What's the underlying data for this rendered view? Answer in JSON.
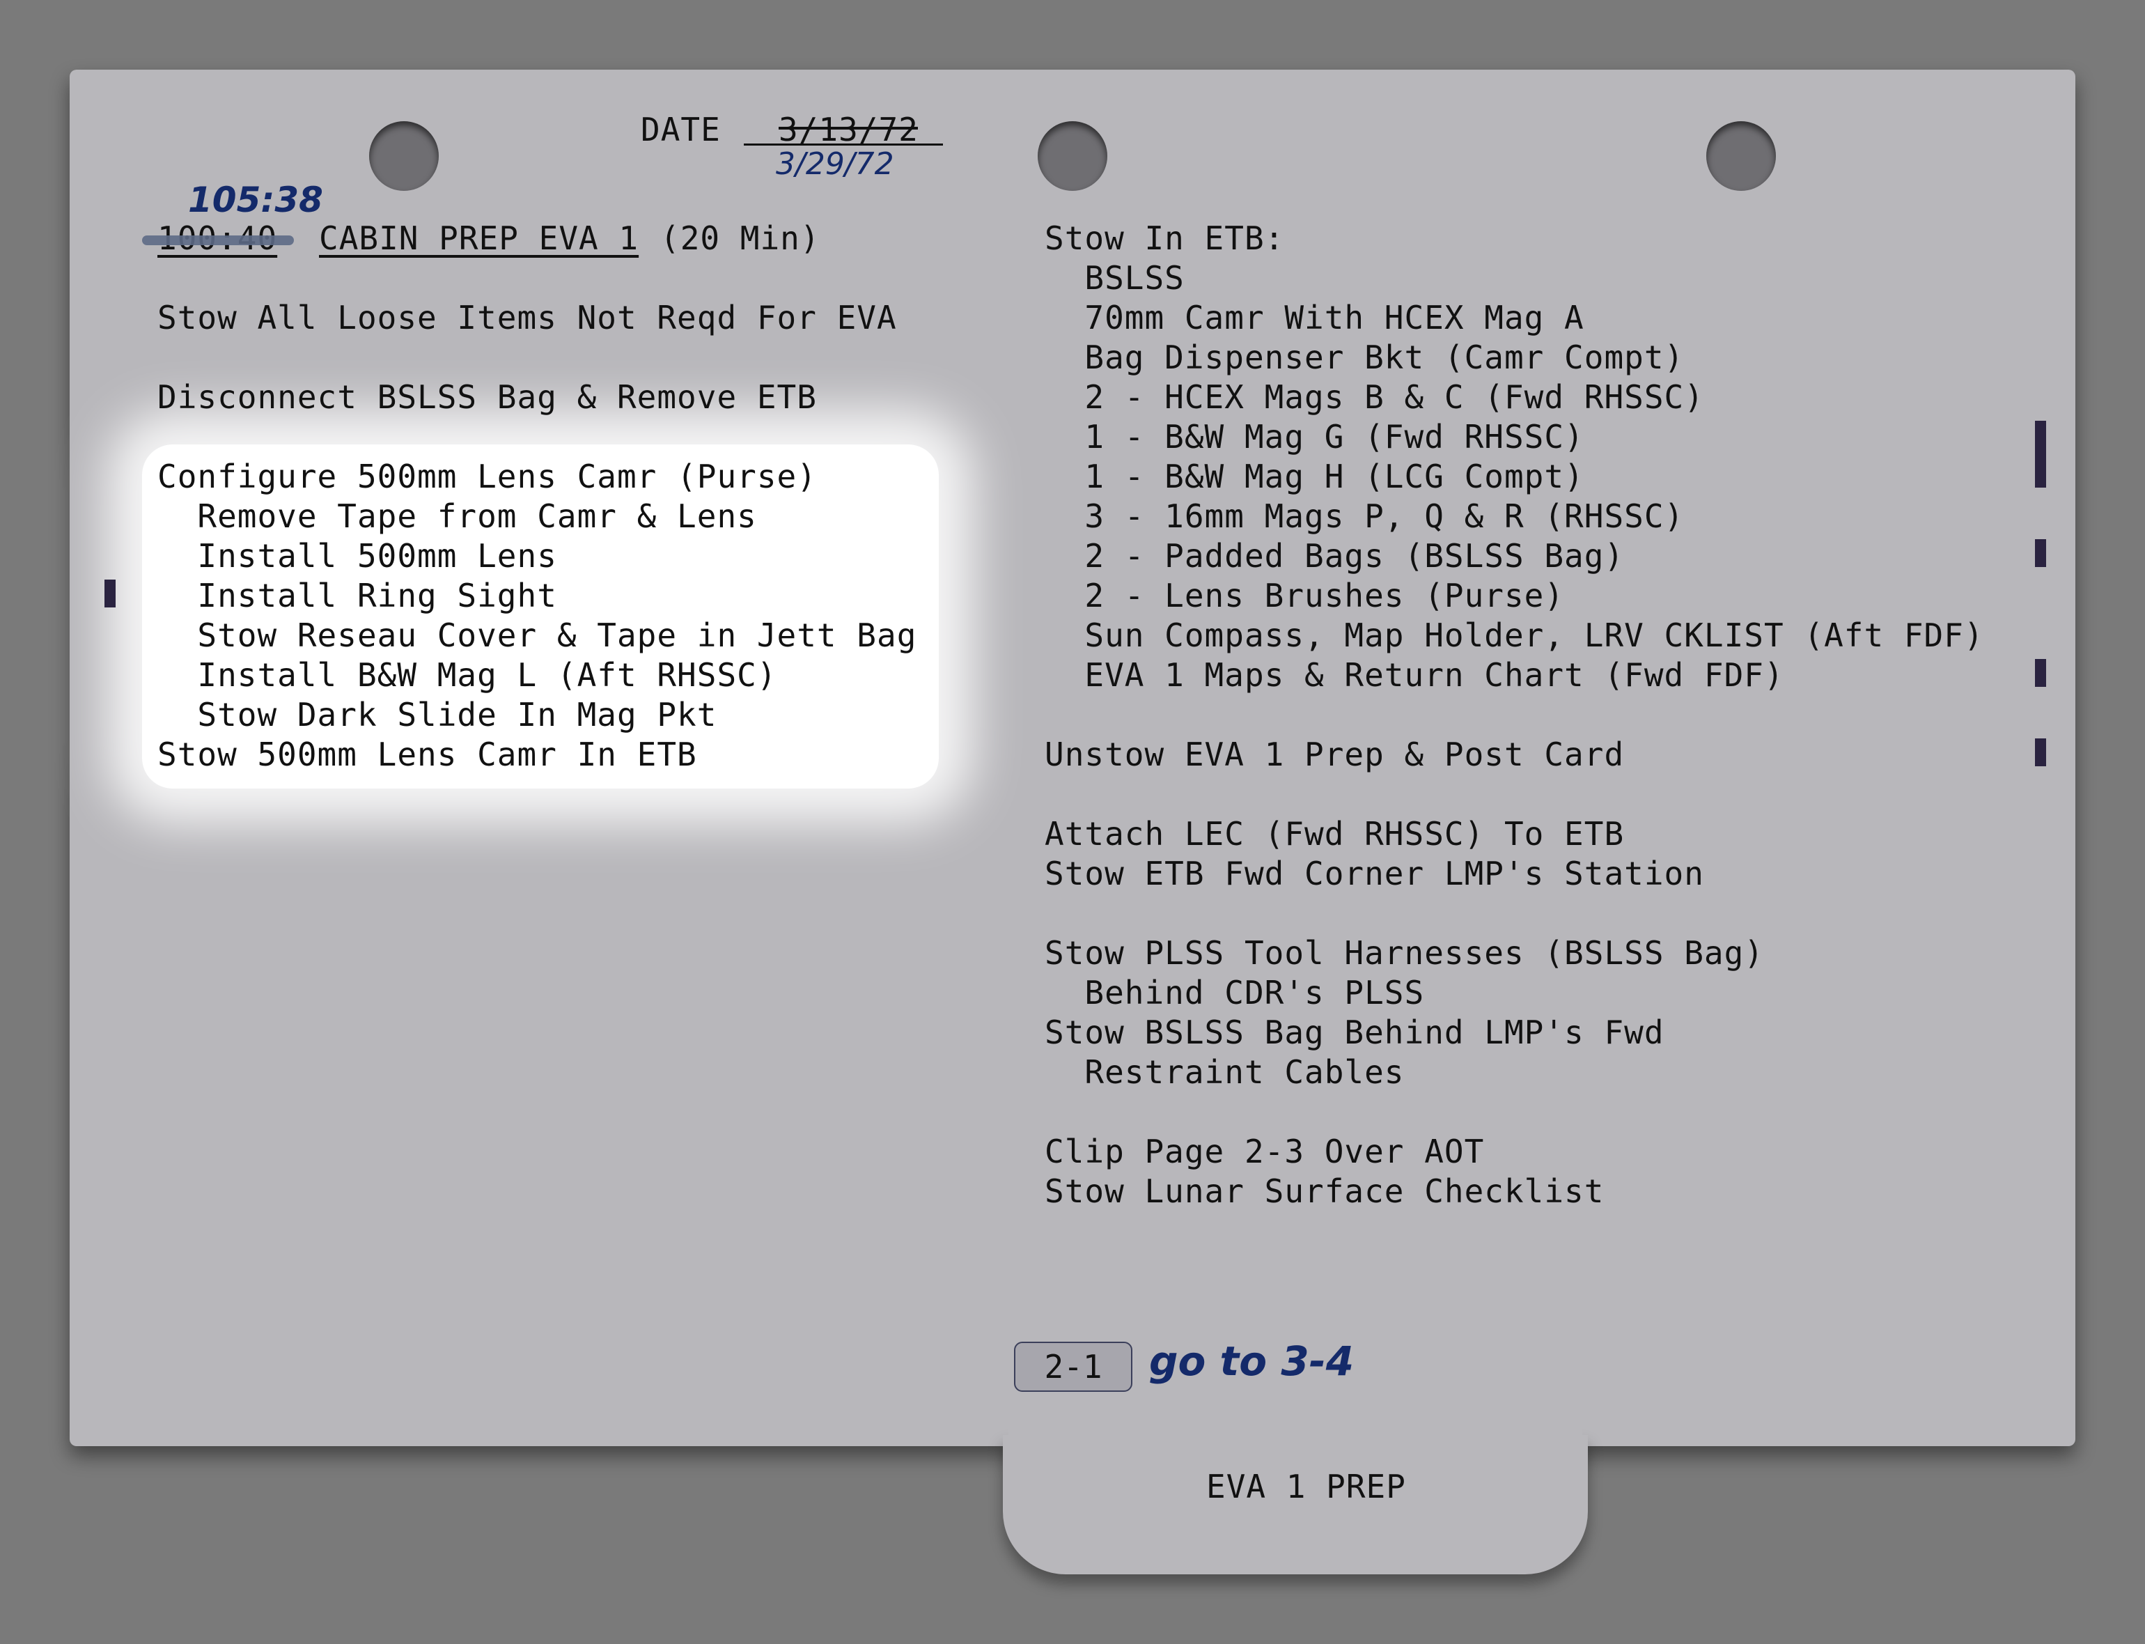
{
  "date": {
    "label": "DATE",
    "original": "3/13/72",
    "revised": "3/29/72"
  },
  "section": {
    "time_original": "100:40",
    "time_revised": "105:38",
    "title": "CABIN PREP EVA 1",
    "duration": "(20 Min)"
  },
  "left_column": [
    "Stow All Loose Items Not Reqd For EVA",
    "Disconnect BSLSS Bag & Remove ETB",
    "Configure 500mm Lens Camr (Purse)",
    "  Remove Tape from Camr & Lens",
    "  Install 500mm Lens",
    "  Install Ring Sight",
    "  Stow Reseau Cover & Tape in Jett Bag",
    "  Install B&W Mag L (Aft RHSSC)",
    "  Stow Dark Slide In Mag Pkt",
    "Stow 500mm Lens Camr In ETB"
  ],
  "right_column": [
    "Stow In ETB:",
    "  BSLSS",
    "  70mm Camr With HCEX Mag A",
    "  Bag Dispenser Bkt (Camr Compt)",
    "  2 - HCEX Mags B & C (Fwd RHSSC)",
    "  1 - B&W Mag G (Fwd RHSSC)",
    "  1 - B&W Mag H (LCG Compt)",
    "  3 - 16mm Mags P, Q & R (RHSSC)",
    "  2 - Padded Bags (BSLSS Bag)",
    "  2 - Lens Brushes (Purse)",
    "  Sun Compass, Map Holder, LRV CKLIST (Aft FDF)",
    "  EVA 1 Maps & Return Chart (Fwd FDF)",
    "Unstow EVA 1 Prep & Post Card",
    "Attach LEC (Fwd RHSSC) To ETB",
    "Stow ETB Fwd Corner LMP's Station",
    "Stow PLSS Tool Harnesses (BSLSS Bag)",
    "  Behind CDR's PLSS",
    "Stow BSLSS Bag Behind LMP's Fwd",
    "  Restraint Cables",
    "Clip Page 2-3 Over AOT",
    "Stow Lunar Surface Checklist"
  ],
  "footer": {
    "page_number": "2-1",
    "handwritten_note": "go to 3-4",
    "tab_label": "EVA 1 PREP"
  }
}
